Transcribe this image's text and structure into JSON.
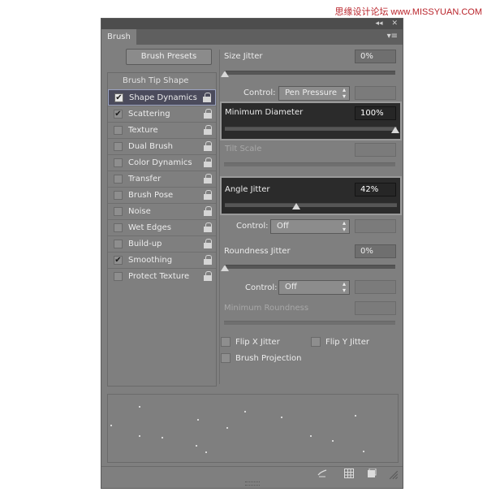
{
  "watermark": "思缘设计论坛 www.MISSYUAN.COM",
  "panel": {
    "tab_label": "Brush",
    "collapse_glyph": "◂◂",
    "close_glyph": "✕",
    "menu_glyph": "▾≡"
  },
  "presets_button": "Brush Presets",
  "list_heading": "Brush Tip Shape",
  "list_items": [
    {
      "label": "Shape Dynamics",
      "checked": true,
      "selected": true
    },
    {
      "label": "Scattering",
      "checked": true
    },
    {
      "label": "Texture",
      "checked": false
    },
    {
      "label": "Dual Brush",
      "checked": false
    },
    {
      "label": "Color Dynamics",
      "checked": false
    },
    {
      "label": "Transfer",
      "checked": false
    },
    {
      "label": "Brush Pose",
      "checked": false
    },
    {
      "label": "Noise",
      "checked": false
    },
    {
      "label": "Wet Edges",
      "checked": false
    },
    {
      "label": "Build-up",
      "checked": false
    },
    {
      "label": "Smoothing",
      "checked": true
    },
    {
      "label": "Protect Texture",
      "checked": false
    }
  ],
  "right": {
    "size_jitter": {
      "label": "Size Jitter",
      "value": "0%"
    },
    "control1": {
      "label": "Control:",
      "value": "Pen Pressure"
    },
    "min_diameter": {
      "label": "Minimum Diameter",
      "value": "100%"
    },
    "tilt_scale": {
      "label": "Tilt Scale"
    },
    "angle_jitter": {
      "label": "Angle Jitter",
      "value": "42%"
    },
    "control2": {
      "label": "Control:",
      "value": "Off"
    },
    "roundness_jitter": {
      "label": "Roundness Jitter",
      "value": "0%"
    },
    "control3": {
      "label": "Control:",
      "value": "Off"
    },
    "min_roundness": {
      "label": "Minimum Roundness"
    },
    "flip_x": "Flip X Jitter",
    "flip_y": "Flip Y Jitter",
    "brush_projection": "Brush Projection"
  },
  "slider_levels": {
    "size_jitter": 0,
    "min_diameter": 1.0,
    "angle_jitter": 0.42,
    "roundness_jitter": 0
  },
  "check_glyph": "✔",
  "arrow_glyph": "▴▾",
  "bottom_icons": [
    "brush-pressure-icon",
    "grid-icon",
    "new-preset-icon"
  ]
}
